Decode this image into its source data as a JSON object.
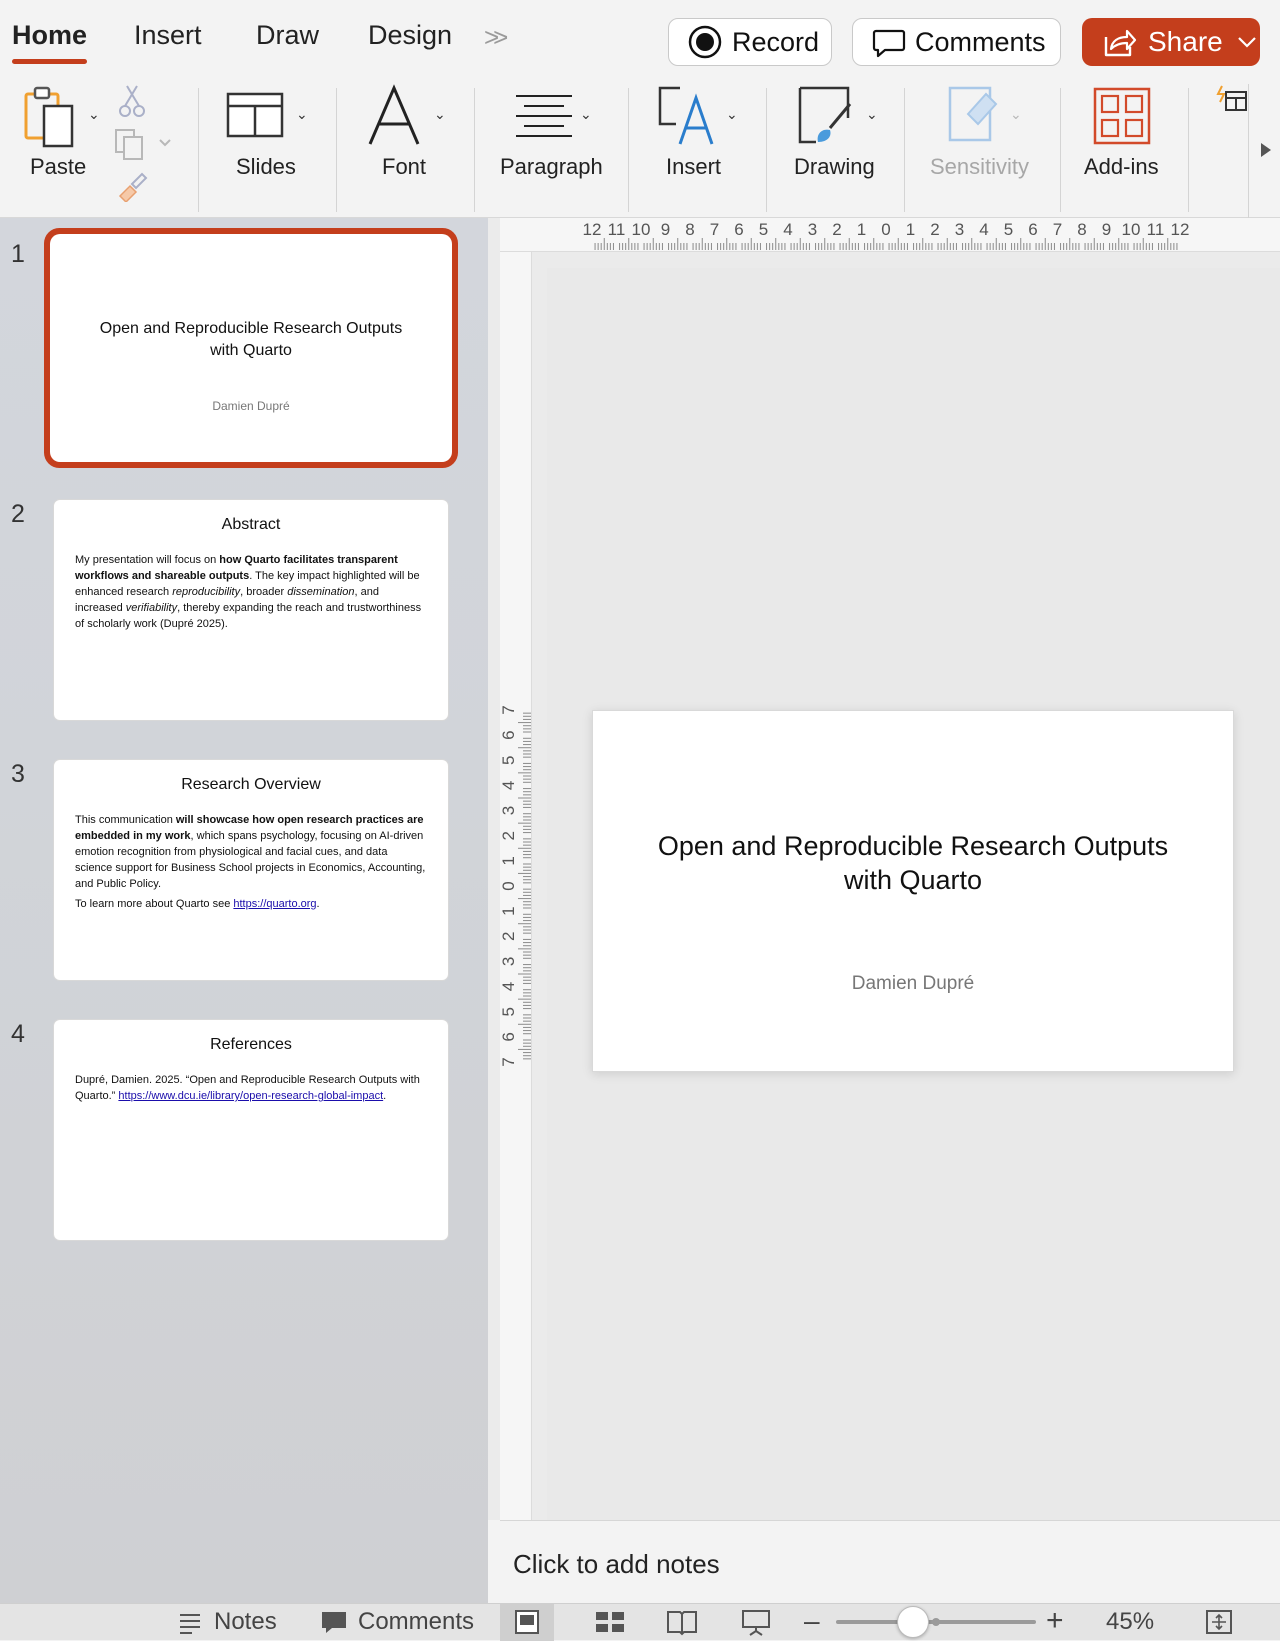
{
  "tabs": [
    {
      "label": "Home",
      "active": true
    },
    {
      "label": "Insert"
    },
    {
      "label": "Draw"
    },
    {
      "label": "Design"
    }
  ],
  "tab_overflow_icon": "chevron-double-right-icon",
  "actions": {
    "record": "Record",
    "comments": "Comments",
    "share": "Share"
  },
  "accent_color": "#c43e1c",
  "ribbon": {
    "paste": "Paste",
    "slides": "Slides",
    "font": "Font",
    "paragraph": "Paragraph",
    "insert": "Insert",
    "drawing": "Drawing",
    "sensitivity": "Sensitivity",
    "addins": "Add-ins"
  },
  "slides": [
    {
      "number": "1",
      "title_line1": "Open and Reproducible Research Outputs",
      "title_line2": "with Quarto",
      "author": "Damien Dupré"
    },
    {
      "number": "2",
      "title": "Abstract",
      "p1": "My presentation will focus on ",
      "p1_b": "how Quarto facilitates transparent workflows and shareable outputs",
      "p1_c": ". The key impact highlighted will be enhanced research ",
      "p1_i1": "reproducibility",
      "p1_d": ", broader ",
      "p1_i2": "dissemination",
      "p1_e": ", and increased ",
      "p1_i3": "verifiability",
      "p1_f": ", thereby expanding the reach and trustworthiness of scholarly work (Dupré 2025)."
    },
    {
      "number": "3",
      "title": "Research Overview",
      "p1": "This communication ",
      "p1_b": "will showcase how open research practices are embedded in my work",
      "p1_c": ", which spans psychology, focusing on AI-driven emotion recognition from physiological and facial cues, and data science support for Business School projects in Economics, Accounting, and Public Policy.",
      "p2": "To learn more about Quarto see ",
      "p2_link": "https://quarto.org",
      "p2_end": "."
    },
    {
      "number": "4",
      "title": "References",
      "p1": "Dupré, Damien. 2025. “Open and Reproducible Research Outputs with Quarto.” ",
      "p1_link": "https://www.dcu.ie/library/open-research-global-impact",
      "p1_end": "."
    }
  ],
  "ruler_h": [
    "12",
    "11",
    "10",
    "9",
    "8",
    "7",
    "6",
    "5",
    "4",
    "3",
    "2",
    "1",
    "0",
    "1",
    "2",
    "3",
    "4",
    "5",
    "6",
    "7",
    "8",
    "9",
    "10",
    "11",
    "12"
  ],
  "ruler_v": [
    "7",
    "6",
    "5",
    "4",
    "3",
    "2",
    "1",
    "0",
    "1",
    "2",
    "3",
    "4",
    "5",
    "6",
    "7"
  ],
  "main_slide": {
    "title_line1": "Open and Reproducible Research Outputs",
    "title_line2": "with Quarto",
    "author": "Damien Dupré"
  },
  "notes_placeholder": "Click to add notes",
  "statusbar": {
    "notes": "Notes",
    "comments": "Comments",
    "zoom": "45%",
    "zoom_level": 0.45
  }
}
